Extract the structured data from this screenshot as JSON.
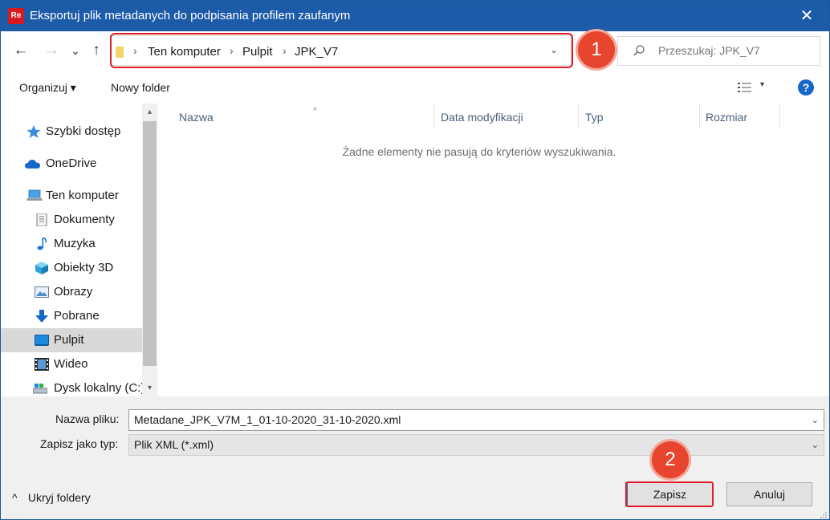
{
  "window": {
    "title": "Eksportuj plik metadanych do podpisania profilem zaufanym",
    "app_icon_text": "Re",
    "close_glyph": "✕"
  },
  "nav": {
    "back_glyph": "←",
    "forward_glyph": "→",
    "recent_glyph": "⌄",
    "up_glyph": "↑",
    "breadcrumbs": [
      "Ten komputer",
      "Pulpit",
      "JPK_V7"
    ],
    "separator_glyph": "›",
    "dropdown_glyph": "⌄",
    "search_placeholder": "Przeszukaj: JPK_V7"
  },
  "annotations": {
    "badge1": "1",
    "badge2": "2"
  },
  "toolbar": {
    "organize_label": "Organizuj ▾",
    "new_folder_label": "Nowy folder",
    "view_caret": "▾",
    "help_glyph": "?"
  },
  "tree": {
    "items": [
      {
        "label": "Szybki dostęp",
        "icon": "star-icon"
      },
      {
        "label": "OneDrive",
        "icon": "cloud-icon"
      },
      {
        "label": "Ten komputer",
        "icon": "computer-icon"
      },
      {
        "label": "Dokumenty",
        "icon": "document-icon"
      },
      {
        "label": "Muzyka",
        "icon": "music-icon"
      },
      {
        "label": "Obiekty 3D",
        "icon": "cube-icon"
      },
      {
        "label": "Obrazy",
        "icon": "image-icon"
      },
      {
        "label": "Pobrane",
        "icon": "download-icon"
      },
      {
        "label": "Pulpit",
        "icon": "desktop-icon",
        "selected": true
      },
      {
        "label": "Wideo",
        "icon": "film-icon"
      },
      {
        "label": "Dysk lokalny (C:)",
        "icon": "drive-icon"
      }
    ],
    "scroll_up": "▴",
    "scroll_down": "▾"
  },
  "filelist": {
    "columns": [
      "Nazwa",
      "Data modyfikacji",
      "Typ",
      "Rozmiar"
    ],
    "sort_caret": "^",
    "empty_message": "Żadne elementy nie pasują do kryteriów wyszukiwania."
  },
  "form": {
    "filename_label": "Nazwa pliku:",
    "filename_value": "Metadane_JPK_V7M_1_01-10-2020_31-10-2020.xml",
    "filetype_label": "Zapisz jako typ:",
    "filetype_value": "Plik XML (*.xml)",
    "caret": "⌄"
  },
  "footer": {
    "hide_folders_label": "Ukryj foldery",
    "hide_folders_glyph": "^",
    "save_label": "Zapisz",
    "cancel_label": "Anuluj"
  },
  "colors": {
    "titlebar": "#1b5ba8",
    "annotation_red": "#e11c24",
    "badge_fill": "#e8452f",
    "selection": "#d9d9d9"
  }
}
